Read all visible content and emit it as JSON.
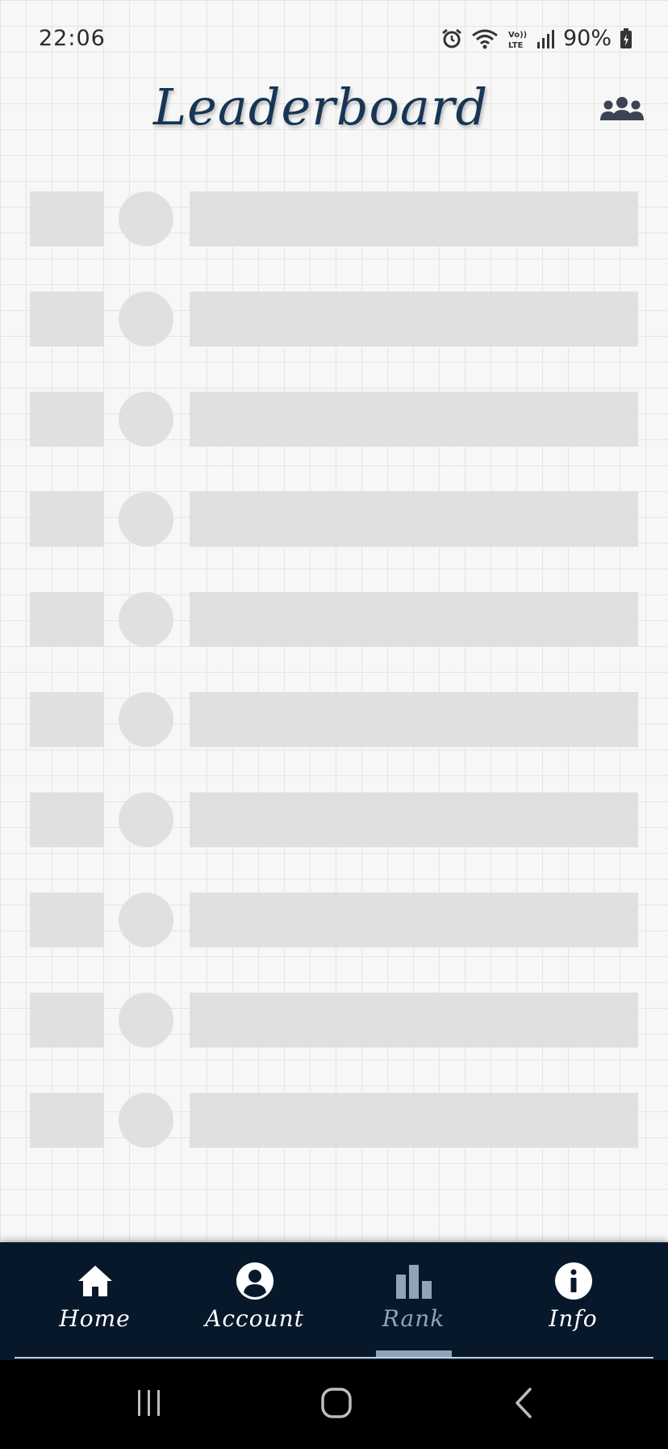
{
  "status_bar": {
    "time": "22:06",
    "battery_percent": "90%",
    "icons": [
      "alarm-icon",
      "wifi-icon",
      "volte-icon",
      "signal-icon",
      "battery-icon"
    ]
  },
  "header": {
    "title": "Leaderboard",
    "right_icon": "group-icon"
  },
  "leaderboard": {
    "state": "loading-placeholder",
    "row_count": 10
  },
  "bottom_nav": {
    "items": [
      {
        "label": "Home",
        "icon": "home-icon",
        "active": false
      },
      {
        "label": "Account",
        "icon": "account-icon",
        "active": false
      },
      {
        "label": "Rank",
        "icon": "bar-chart-icon",
        "active": true
      },
      {
        "label": "Info",
        "icon": "info-icon",
        "active": false
      }
    ]
  },
  "system_nav": {
    "buttons": [
      "recent-apps-icon",
      "home-circle-icon",
      "back-icon"
    ]
  },
  "colors": {
    "title": "#173554",
    "nav_background": "#06182a",
    "nav_active": "#8fa4b8",
    "placeholder": "#e0e0e0"
  }
}
